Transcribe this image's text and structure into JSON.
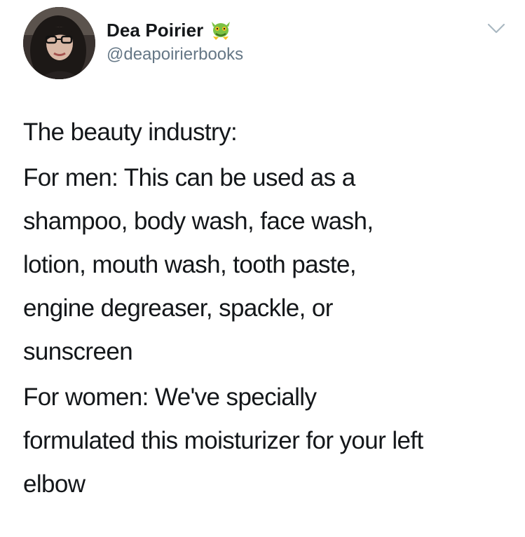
{
  "tweet": {
    "author": {
      "display_name": "Dea Poirier",
      "handle": "@deapoirierbooks",
      "avatar_icon": "profile-photo",
      "name_emoji_icon": "green-dragon-emoji"
    },
    "menu_icon": "chevron-down-icon",
    "paragraphs": [
      "The beauty industry:",
      "For men: This can be used as a\nshampoo, body wash, face wash,\nlotion, mouth wash, tooth paste,\nengine degreaser, spackle, or\nsunscreen",
      "For women: We've specially\nformulated this moisturizer for your left\nelbow"
    ]
  },
  "colors": {
    "text_primary": "#14171a",
    "text_secondary": "#657786",
    "caret": "#aab8c2",
    "emoji_green": "#7ac143",
    "emoji_yellow": "#f4c01e"
  }
}
